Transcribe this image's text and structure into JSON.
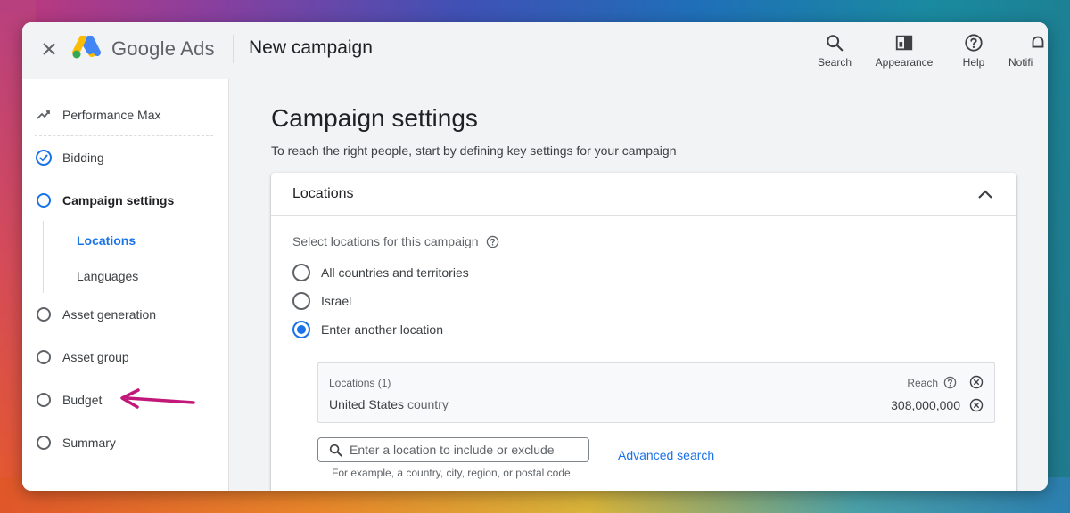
{
  "header": {
    "brand": "Google Ads",
    "title": "New campaign",
    "actions": [
      {
        "label": "Search",
        "icon": "search-icon"
      },
      {
        "label": "Appearance",
        "icon": "appearance-icon"
      },
      {
        "label": "Help",
        "icon": "help-icon"
      },
      {
        "label": "Notifi",
        "icon": "notifications-icon"
      }
    ]
  },
  "sidebar": {
    "items": [
      {
        "label": "Performance Max",
        "icon": "performance-icon"
      },
      {
        "label": "Bidding",
        "icon": "check-circle-icon",
        "state": "complete"
      },
      {
        "label": "Campaign settings",
        "icon": "circle-icon",
        "state": "current"
      },
      {
        "label": "Asset generation",
        "icon": "circle-icon"
      },
      {
        "label": "Asset group",
        "icon": "circle-icon"
      },
      {
        "label": "Budget",
        "icon": "circle-icon"
      },
      {
        "label": "Summary",
        "icon": "circle-icon"
      }
    ],
    "subitems": [
      {
        "label": "Locations",
        "active": true
      },
      {
        "label": "Languages",
        "active": false
      }
    ]
  },
  "main": {
    "title": "Campaign settings",
    "subtitle": "To reach the right people, start by defining key settings for your campaign",
    "card": {
      "title": "Locations",
      "select_label": "Select locations for this campaign",
      "options": [
        {
          "label": "All countries and territories",
          "checked": false
        },
        {
          "label": "Israel",
          "checked": false
        },
        {
          "label": "Enter another location",
          "checked": true
        }
      ],
      "locations_header": "Locations (1)",
      "reach_label": "Reach",
      "location": {
        "name": "United States",
        "type": "country",
        "reach": "308,000,000"
      },
      "search_placeholder": "Enter a location to include or exclude",
      "hint": "For example, a country, city, region, or postal code",
      "advanced_search": "Advanced search"
    }
  },
  "colors": {
    "accent": "#1a73e8",
    "annotation_arrow": "#c2187a"
  }
}
